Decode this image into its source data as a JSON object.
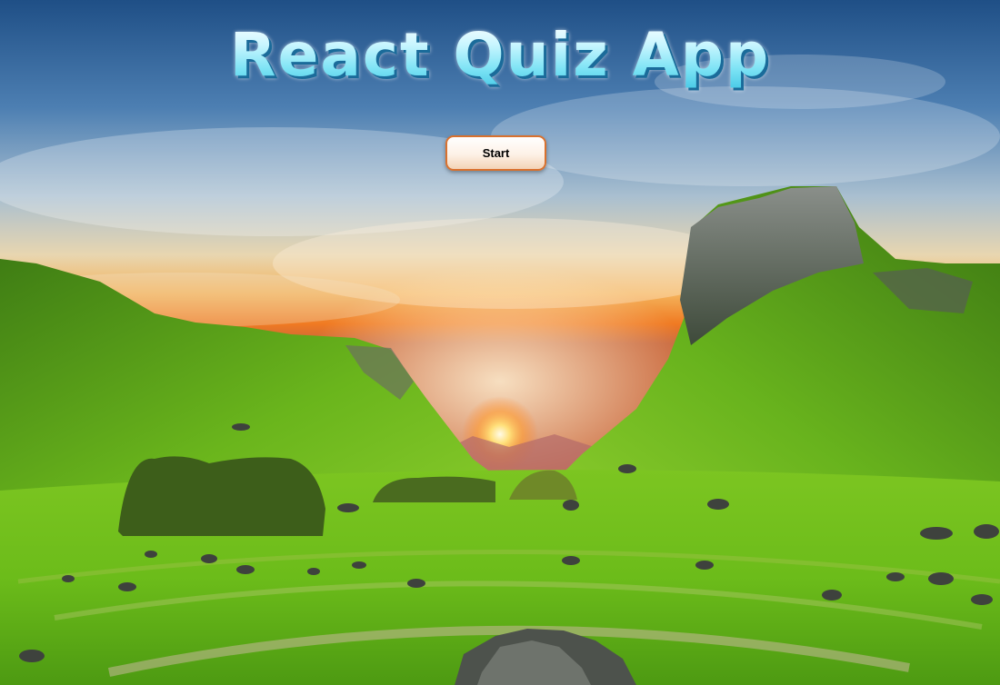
{
  "app": {
    "title": "React Quiz App",
    "start_button_label": "Start"
  },
  "colors": {
    "title_fill": "#bff3ff",
    "title_shadow": "#1a6b9a",
    "button_border": "#d9712e",
    "button_bg": "#fdf1e6"
  },
  "background": {
    "scene": "landscape-photo"
  }
}
